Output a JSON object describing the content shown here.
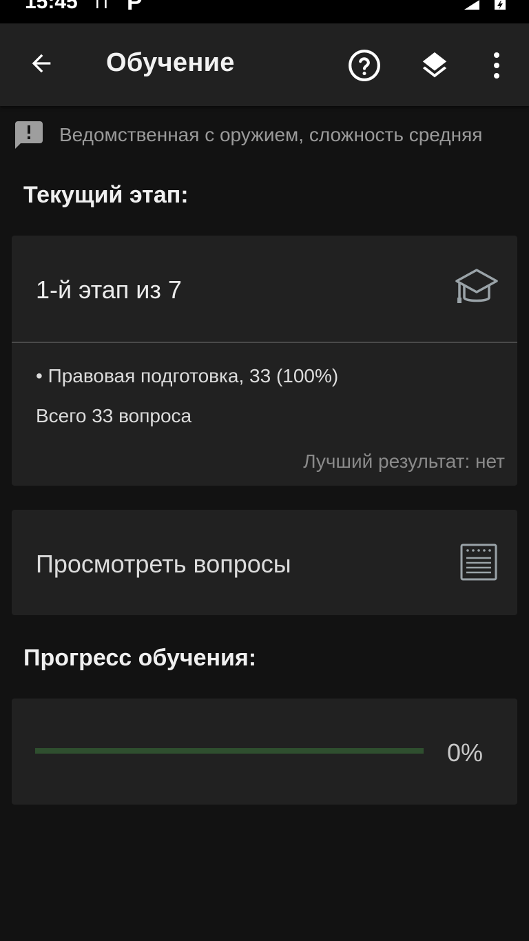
{
  "status_bar": {
    "time": "15:45",
    "notification_glyph": "П",
    "app_badge": "P"
  },
  "app_bar": {
    "title": "Обучение",
    "back_icon": "arrow-left",
    "help_icon": "question-circle",
    "layers_icon": "layers",
    "menu_icon": "more-vertical"
  },
  "info": {
    "icon": "alert-message",
    "text": "Ведомственная с оружием, сложность средняя"
  },
  "current_stage": {
    "heading": "Текущий этап:",
    "title": "1-й этап из 7",
    "icon": "graduation-cap",
    "item": "• Правовая подготовка, 33 (100%)",
    "total": "Всего 33 вопроса",
    "best_result": "Лучший результат: нет"
  },
  "questions": {
    "label": "Просмотреть вопросы",
    "icon": "document-list"
  },
  "progress": {
    "heading": "Прогресс обучения:",
    "value_text": "0%",
    "fraction": 0
  },
  "colors": {
    "background": "#121212",
    "surface": "#212121",
    "accent_green": "#4caf50",
    "track_green": "#2f4f2f"
  }
}
